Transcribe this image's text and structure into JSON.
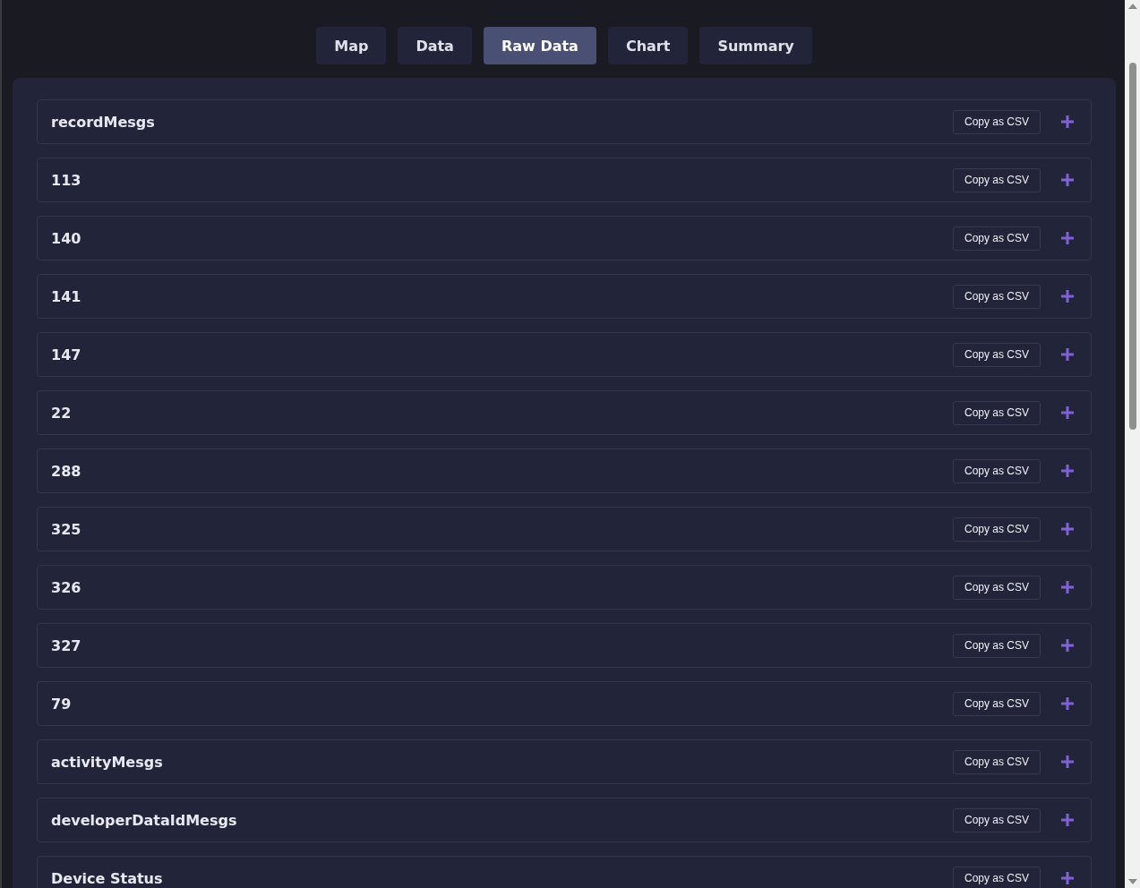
{
  "tabs": [
    {
      "label": "Map",
      "selected": false
    },
    {
      "label": "Data",
      "selected": false
    },
    {
      "label": "Raw Data",
      "selected": true
    },
    {
      "label": "Chart",
      "selected": false
    },
    {
      "label": "Summary",
      "selected": false
    }
  ],
  "sections": [
    {
      "title": "recordMesgs",
      "copy_label": "Copy as CSV",
      "expanded": false
    },
    {
      "title": "113",
      "copy_label": "Copy as CSV",
      "expanded": false
    },
    {
      "title": "140",
      "copy_label": "Copy as CSV",
      "expanded": false
    },
    {
      "title": "141",
      "copy_label": "Copy as CSV",
      "expanded": false
    },
    {
      "title": "147",
      "copy_label": "Copy as CSV",
      "expanded": false
    },
    {
      "title": "22",
      "copy_label": "Copy as CSV",
      "expanded": false
    },
    {
      "title": "288",
      "copy_label": "Copy as CSV",
      "expanded": false
    },
    {
      "title": "325",
      "copy_label": "Copy as CSV",
      "expanded": false
    },
    {
      "title": "326",
      "copy_label": "Copy as CSV",
      "expanded": false
    },
    {
      "title": "327",
      "copy_label": "Copy as CSV",
      "expanded": false
    },
    {
      "title": "79",
      "copy_label": "Copy as CSV",
      "expanded": false
    },
    {
      "title": "activityMesgs",
      "copy_label": "Copy as CSV",
      "expanded": false
    },
    {
      "title": "developerDataIdMesgs",
      "copy_label": "Copy as CSV",
      "expanded": false
    },
    {
      "title": "Device Status",
      "copy_label": "Copy as CSV",
      "expanded": false
    }
  ]
}
